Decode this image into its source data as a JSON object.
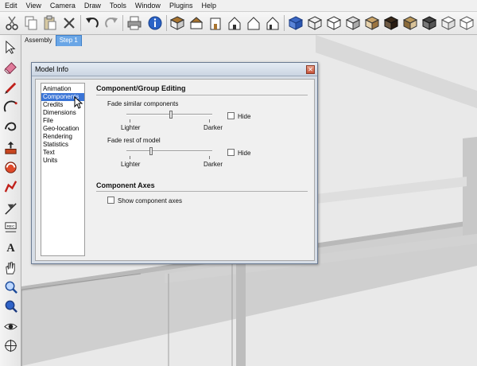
{
  "menu": {
    "items": [
      "Edit",
      "View",
      "Camera",
      "Draw",
      "Tools",
      "Window",
      "Plugins",
      "Help"
    ]
  },
  "toolbar": {
    "icons": [
      "cut-icon",
      "copy-icon",
      "paste-icon",
      "erase-icon",
      "undo-icon",
      "redo-icon",
      "print-icon",
      "model-info-icon",
      "iso-view-icon",
      "top-view-icon",
      "front-view-icon",
      "right-view-icon",
      "back-view-icon",
      "left-view-icon",
      "xray-icon",
      "wireframe-icon",
      "hidden-line-icon",
      "shaded-icon",
      "textured-icon",
      "monochrome-icon"
    ]
  },
  "scene_tabs": {
    "assembly": "Assembly",
    "step1": "Step 1"
  },
  "dialog": {
    "title": "Model Info",
    "close_glyph": "✕",
    "nav_items": [
      "Animation",
      "Components",
      "Credits",
      "Dimensions",
      "File",
      "Geo-location",
      "Rendering",
      "Statistics",
      "Text",
      "Units"
    ],
    "selected_nav": "Components",
    "section1_title": "Component/Group Editing",
    "fade_similar_label": "Fade similar components",
    "fade_rest_label": "Fade rest of model",
    "lighter_label": "Lighter",
    "darker_label": "Darker",
    "hide_label": "Hide",
    "section2_title": "Component Axes",
    "show_axes_label": "Show component axes",
    "fade_similar_level": 0.52,
    "fade_rest_level": 0.28,
    "hide_similar_checked": false,
    "hide_rest_checked": false,
    "show_axes_checked": false
  }
}
